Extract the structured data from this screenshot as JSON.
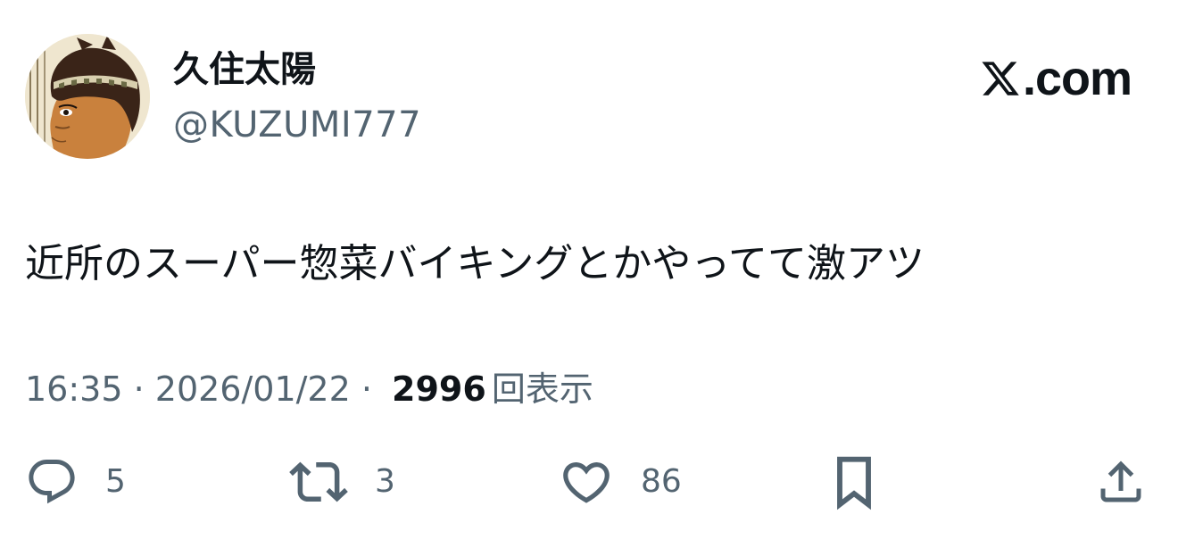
{
  "author": {
    "display_name": "久住太陽",
    "handle": "@KUZUMI777"
  },
  "brand": {
    "suffix": ".com",
    "icon": "x-logo-icon"
  },
  "tweet": {
    "text": "近所のスーパー惣菜バイキングとかやってて激アツ"
  },
  "meta": {
    "time": "16:35",
    "separator1": " · ",
    "date": "2026/01/22",
    "separator2": " · ",
    "views_count": "2996",
    "views_label": "回表示"
  },
  "actions": {
    "reply": {
      "icon": "reply-icon",
      "count": "5"
    },
    "retweet": {
      "icon": "retweet-icon",
      "count": "3"
    },
    "like": {
      "icon": "heart-icon",
      "count": "86"
    },
    "bookmark": {
      "icon": "bookmark-icon"
    },
    "share": {
      "icon": "share-icon"
    }
  },
  "colors": {
    "text_primary": "#0f1419",
    "text_secondary": "#536471",
    "background": "#ffffff"
  }
}
